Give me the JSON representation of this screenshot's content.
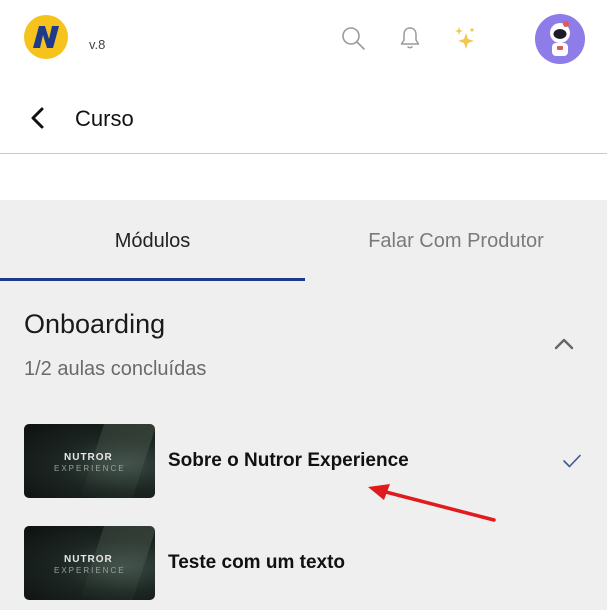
{
  "app": {
    "version": "v.8",
    "colors": {
      "accent": "#1e3a8a",
      "logo_yellow": "#f6c21c",
      "logo_blue": "#1e3a8a",
      "avatar_bg": "#8e7ce8",
      "sparkle": "#f2c94c",
      "annotation_arrow": "#e01b1b"
    }
  },
  "topbar": {
    "icons": [
      "logo",
      "search-icon",
      "bell-icon",
      "sparkle-icon",
      "avatar"
    ]
  },
  "header": {
    "title": "Curso"
  },
  "tabs": [
    {
      "label": "Módulos",
      "active": true
    },
    {
      "label": "Falar Com Produtor",
      "active": false
    }
  ],
  "module": {
    "title": "Onboarding",
    "progress": "1/2 aulas concluídas",
    "expanded": true,
    "lessons": [
      {
        "title": "Sobre o Nutror Experience",
        "thumb_title": "NUTROR",
        "thumb_sub": "EXPERIENCE",
        "completed": true
      },
      {
        "title": "Teste com um texto",
        "thumb_title": "NUTROR",
        "thumb_sub": "EXPERIENCE",
        "completed": false
      }
    ]
  }
}
